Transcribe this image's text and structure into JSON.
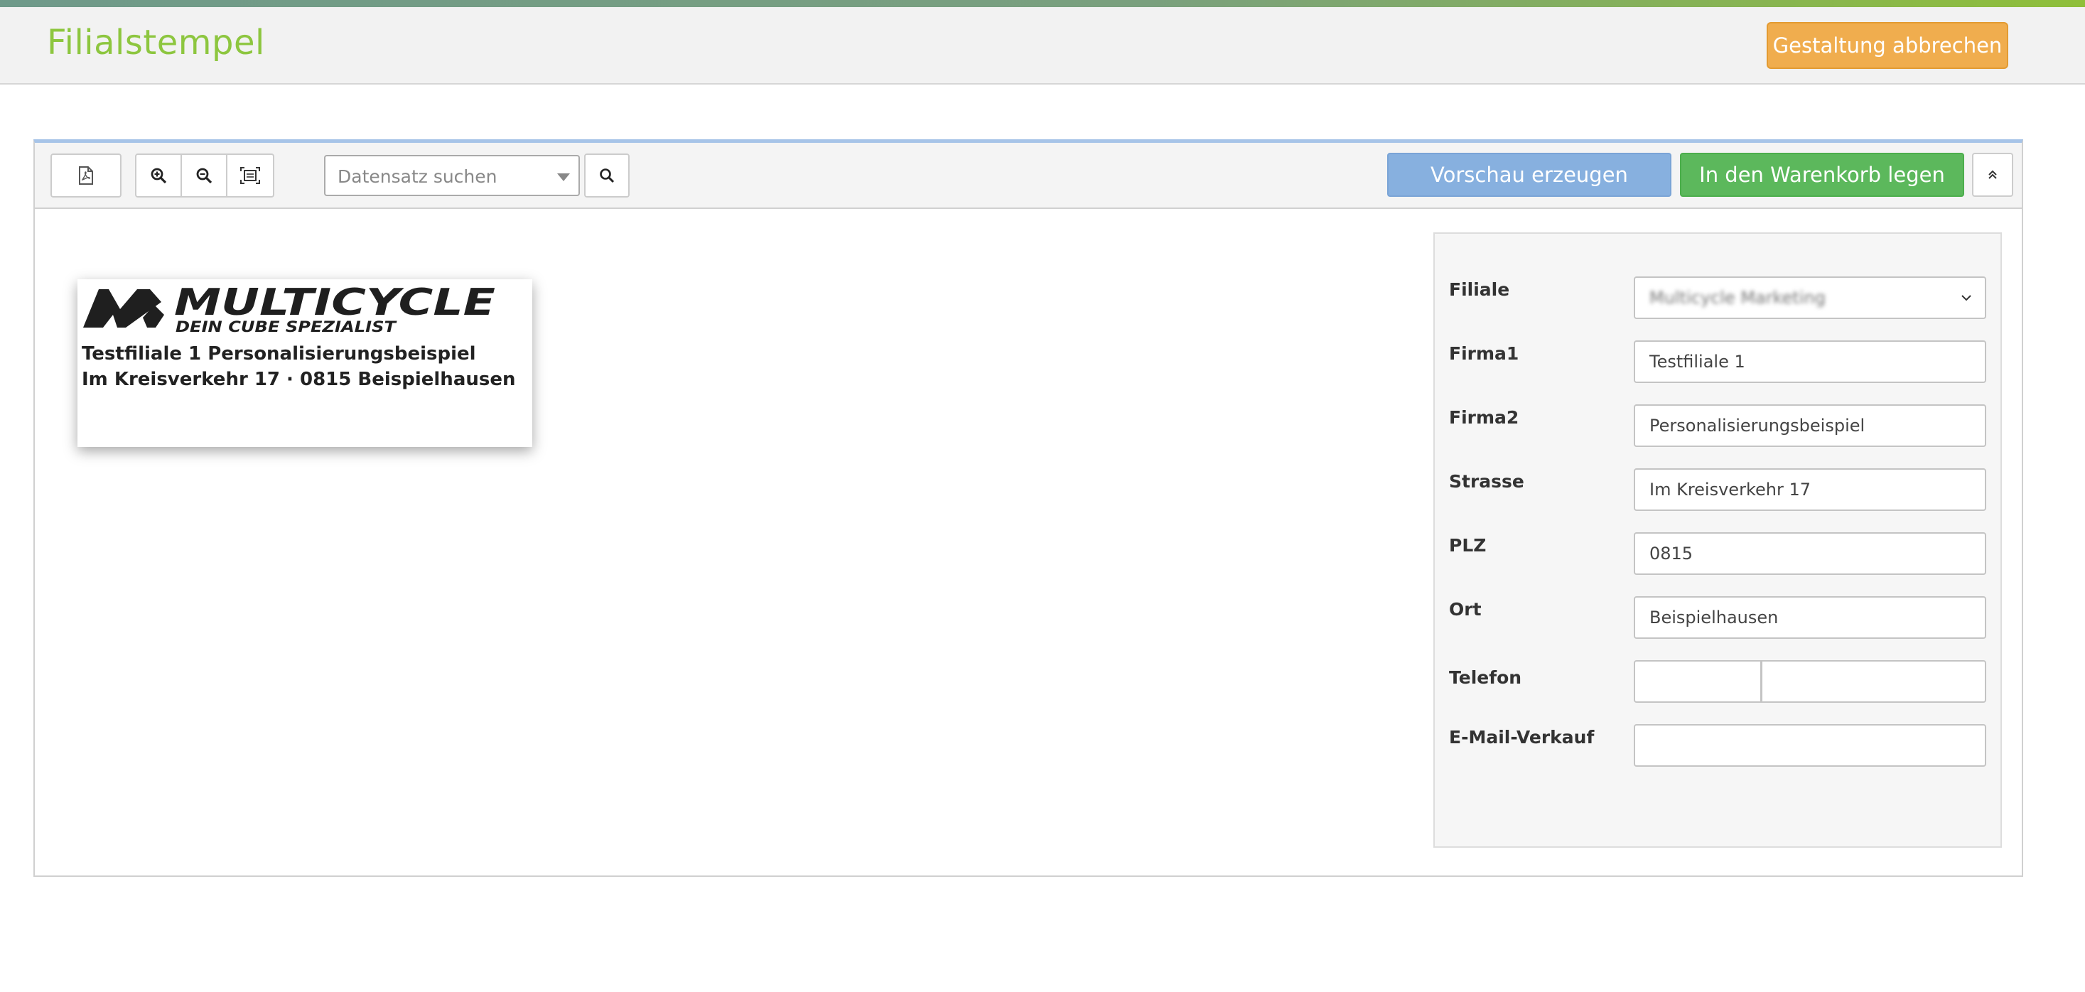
{
  "header": {
    "title": "Filialstempel",
    "cancel_label": "Gestaltung abbrechen"
  },
  "toolbar": {
    "pdf_icon": "pdf-file-icon",
    "zoom_in_icon": "zoom-in-icon",
    "zoom_out_icon": "zoom-out-icon",
    "fit_icon": "fit-page-icon",
    "dataset_placeholder": "Datensatz suchen",
    "search_icon": "search-icon",
    "preview_label": "Vorschau erzeugen",
    "cart_label": "In den Warenkorb legen",
    "collapse_icon": "chevron-double-up-icon"
  },
  "stamp": {
    "logo_text": "MULTICYCLE",
    "logo_tagline": "DEIN CUBE SPEZIALIST",
    "line1": "Testfiliale 1 Personalisierungsbeispiel",
    "line2": "Im Kreisverkehr 17 · 0815 Beispielhausen"
  },
  "form": {
    "filiale": {
      "label": "Filiale",
      "value": "Multicycle Marketing"
    },
    "firma1": {
      "label": "Firma1",
      "value": "Testfiliale 1"
    },
    "firma2": {
      "label": "Firma2",
      "value": "Personalisierungsbeispiel"
    },
    "strasse": {
      "label": "Strasse",
      "value": "Im Kreisverkehr 17"
    },
    "plz": {
      "label": "PLZ",
      "value": "0815"
    },
    "ort": {
      "label": "Ort",
      "value": "Beispielhausen"
    },
    "telefon": {
      "label": "Telefon",
      "prefix": "",
      "number": ""
    },
    "email": {
      "label": "E-Mail-Verkauf",
      "value": ""
    }
  },
  "colors": {
    "title_green": "#8dc63f",
    "cancel_orange": "#f0ad4e",
    "preview_blue": "#87b0df",
    "cart_green": "#5cb85c"
  }
}
